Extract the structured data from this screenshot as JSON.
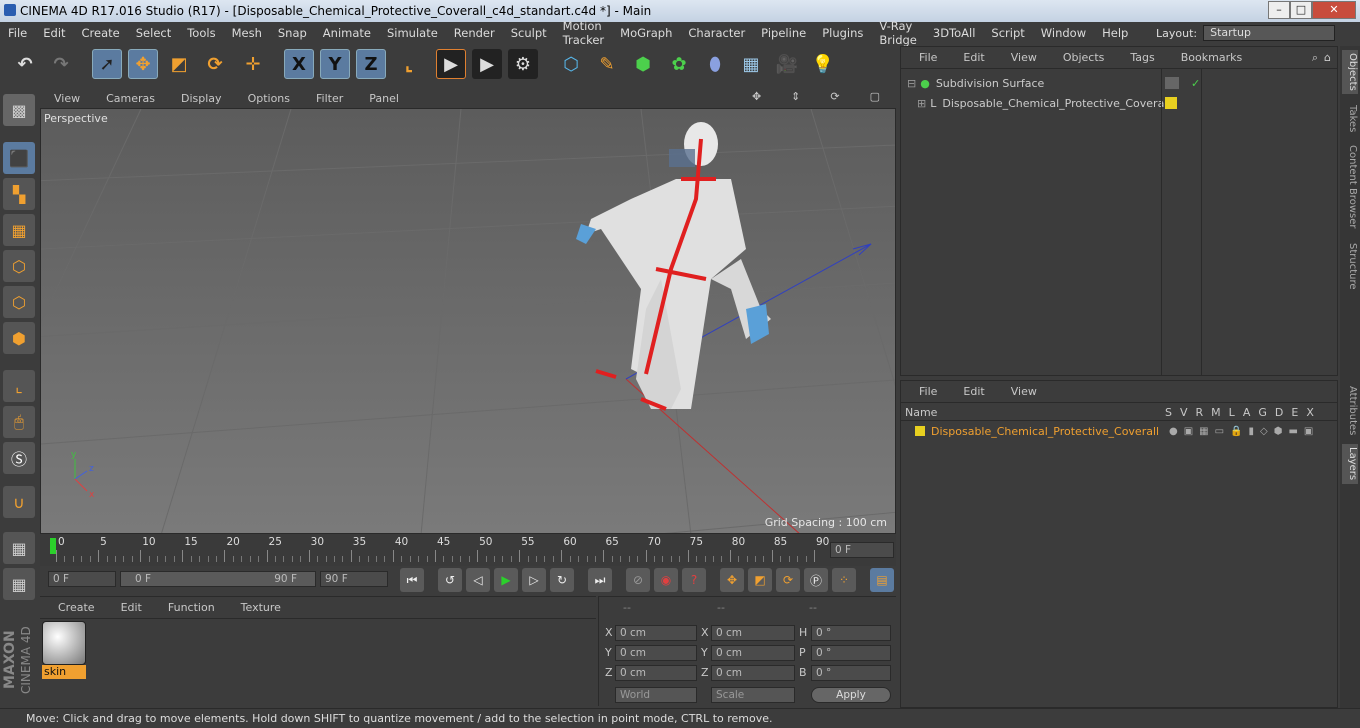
{
  "window": {
    "title": "CINEMA 4D R17.016 Studio (R17) - [Disposable_Chemical_Protective_Coverall_c4d_standart.c4d *] - Main"
  },
  "menu": [
    "File",
    "Edit",
    "Create",
    "Select",
    "Tools",
    "Mesh",
    "Snap",
    "Animate",
    "Simulate",
    "Render",
    "Sculpt",
    "Motion Tracker",
    "MoGraph",
    "Character",
    "Pipeline",
    "Plugins",
    "V-Ray Bridge",
    "3DToAll",
    "Script",
    "Window",
    "Help"
  ],
  "layout": {
    "label": "Layout:",
    "value": "Startup"
  },
  "toolbar": {
    "x": "X",
    "y": "Y",
    "z": "Z"
  },
  "viewport": {
    "menu": [
      "View",
      "Cameras",
      "Display",
      "Options",
      "Filter",
      "Panel"
    ],
    "label": "Perspective",
    "grid_spacing": "Grid Spacing : 100 cm"
  },
  "timeline": {
    "ticks": [
      "0",
      "5",
      "10",
      "15",
      "20",
      "25",
      "30",
      "35",
      "40",
      "45",
      "50",
      "55",
      "60",
      "65",
      "70",
      "75",
      "80",
      "85",
      "90"
    ],
    "current": "0 F",
    "start": "0 F",
    "range_start": "0 F",
    "range_end": "90 F",
    "end": "90 F"
  },
  "material": {
    "menu": [
      "Create",
      "Edit",
      "Function",
      "Texture"
    ],
    "name": "skin"
  },
  "coords": {
    "headers": [
      "--",
      "--",
      "--"
    ],
    "rows": [
      {
        "a": "X",
        "av": "0 cm",
        "b": "X",
        "bv": "0 cm",
        "c": "H",
        "cv": "0 °"
      },
      {
        "a": "Y",
        "av": "0 cm",
        "b": "Y",
        "bv": "0 cm",
        "c": "P",
        "cv": "0 °"
      },
      {
        "a": "Z",
        "av": "0 cm",
        "b": "Z",
        "bv": "0 cm",
        "c": "B",
        "cv": "0 °"
      }
    ],
    "world": "World",
    "scale": "Scale",
    "apply": "Apply"
  },
  "objects": {
    "menu": [
      "File",
      "Edit",
      "View",
      "Objects",
      "Tags",
      "Bookmarks"
    ],
    "items": [
      "Subdivision Surface",
      "Disposable_Chemical_Protective_Coverall"
    ]
  },
  "layers": {
    "menu": [
      "File",
      "Edit",
      "View"
    ],
    "col_name": "Name",
    "cols": [
      "S",
      "V",
      "R",
      "M",
      "L",
      "A",
      "G",
      "D",
      "E",
      "X"
    ],
    "item": "Disposable_Chemical_Protective_Coverall"
  },
  "right_tabs": [
    "Objects",
    "Takes",
    "Content Browser",
    "Structure",
    "Attributes",
    "Layers"
  ],
  "brand": {
    "line1": "MAXON",
    "line2": "CINEMA 4D"
  },
  "status": "Move: Click and drag to move elements. Hold down SHIFT to quantize movement / add to the selection in point mode, CTRL to remove.",
  "colors": {
    "accent": "#5b7ba0",
    "layer": "#e8d020",
    "selection": "#f0a030",
    "suit_stripe": "#e02020"
  }
}
